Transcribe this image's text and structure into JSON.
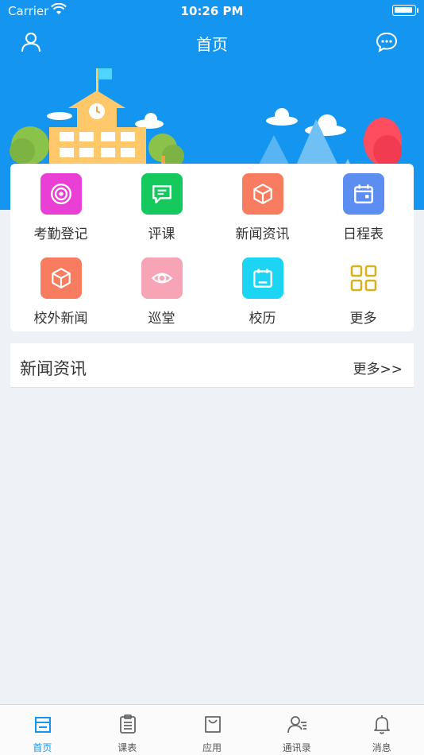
{
  "status_bar": {
    "carrier": "Carrier",
    "time": "10:26 PM"
  },
  "nav": {
    "title": "首页",
    "left_icon": "user-icon",
    "right_icon": "chat-bubble-icon"
  },
  "quick_menu": [
    {
      "label": "考勤登记",
      "icon": "radar-icon",
      "color": "#e93fd5"
    },
    {
      "label": "评课",
      "icon": "comment-icon",
      "color": "#15c95e"
    },
    {
      "label": "新闻资讯",
      "icon": "cube-icon",
      "color": "#f87d60"
    },
    {
      "label": "日程表",
      "icon": "calendar-icon",
      "color": "#5b8ef0"
    },
    {
      "label": "校外新闻",
      "icon": "cube-icon",
      "color": "#f87d60"
    },
    {
      "label": "巡堂",
      "icon": "eye-icon",
      "color": "#f7a4b7"
    },
    {
      "label": "校历",
      "icon": "calendar-frame-icon",
      "color": "#1cd5f5"
    },
    {
      "label": "更多",
      "icon": "grid-icon",
      "color": "#d6b21f"
    }
  ],
  "news_section": {
    "title": "新闻资讯",
    "more": "更多>>"
  },
  "tab_bar": [
    {
      "label": "首页",
      "icon": "home-icon",
      "active": true
    },
    {
      "label": "课表",
      "icon": "clipboard-icon",
      "active": false
    },
    {
      "label": "应用",
      "icon": "bag-icon",
      "active": false
    },
    {
      "label": "通讯录",
      "icon": "contacts-icon",
      "active": false
    },
    {
      "label": "消息",
      "icon": "bell-icon",
      "active": false
    }
  ],
  "colors": {
    "primary": "#1496f0",
    "background": "#eef1f5"
  }
}
